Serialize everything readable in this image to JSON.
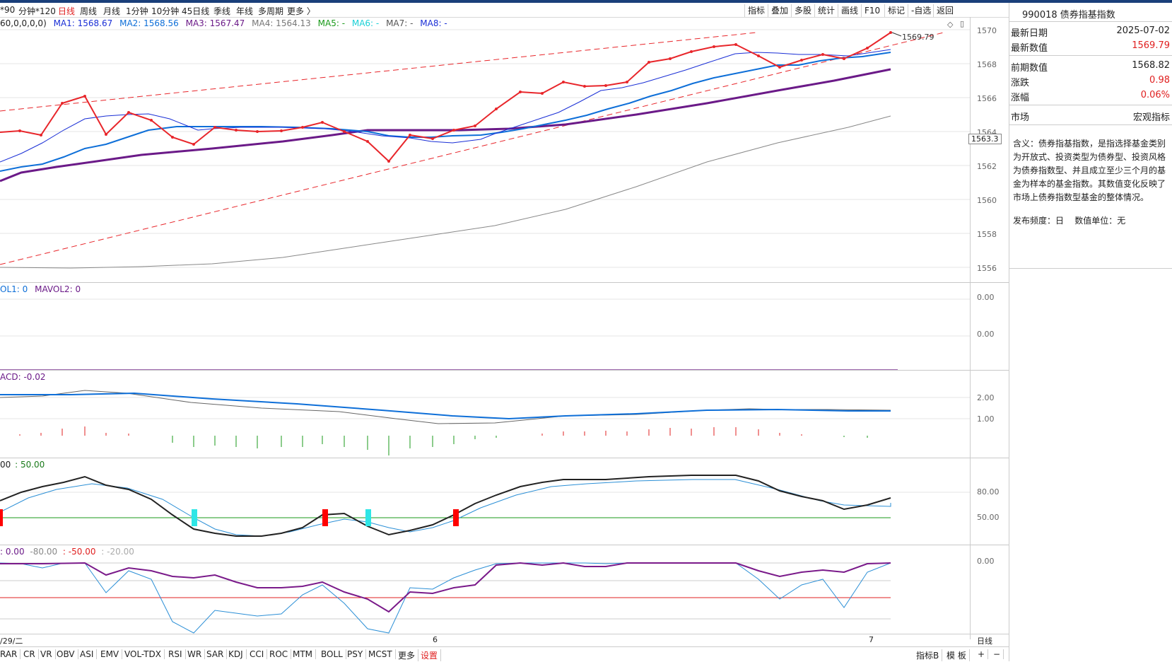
{
  "tabs": {
    "left_fragment": "*90",
    "items": [
      "分钟*120",
      "日线",
      "周线",
      "月线",
      "1分钟",
      "10分钟",
      "45日线",
      "季线",
      "年线",
      "多周期",
      "更多 〉"
    ],
    "active": "日线"
  },
  "toolbar": [
    "指标",
    "叠加",
    "多股",
    "统计",
    "画线",
    "F10",
    "标记",
    "-自选",
    "返回"
  ],
  "ma_legend": {
    "params": "60,0,0,0,0)",
    "ma1": "MA1: 1568.67",
    "ma2": "MA2: 1568.56",
    "ma3": "MA3: 1567.47",
    "ma4": "MA4: 1564.13",
    "ma5": "MA5: -",
    "ma6": "MA6: -",
    "ma7": "MA7: -",
    "ma8": "MA8: -"
  },
  "main_y_labels": [
    "1570",
    "1568",
    "1566",
    "1564",
    "1562",
    "1560",
    "1558",
    "1556"
  ],
  "current_price_tag": "1563.3",
  "high_annotation": "1569.79",
  "vol_legend": {
    "vol1": "OL1: 0",
    "mavol2": "MAVOL2: 0"
  },
  "vol_y_labels": [
    "0.00",
    "0.00"
  ],
  "macd_legend": "ACD: -0.02",
  "macd_y_labels": [
    "2.00",
    "1.00"
  ],
  "kdj_legend": {
    "a": "00",
    "b": ": 50.00"
  },
  "kdj_y_labels": [
    "80.00",
    "50.00"
  ],
  "wr_legend": {
    "a": ": 0.00",
    "b": "-80.00",
    "c": ": -50.00",
    "d": ": -20.00"
  },
  "wr_y_labels": [
    "0.00"
  ],
  "date_axis": {
    "left": "/29/二",
    "mid": "6",
    "right": "7",
    "period": "日线"
  },
  "bottom_tabs": [
    "RAR",
    "CR",
    "VR",
    "OBV",
    "ASI",
    "EMV",
    "VOL-TDX",
    "RSI",
    "WR",
    "SAR",
    "KDJ",
    "CCI",
    "ROC",
    "MTM",
    "BOLL",
    "PSY",
    "MCST",
    "更多",
    "设置"
  ],
  "bottom_right": [
    "指标B",
    "模 板",
    "+",
    "−"
  ],
  "info_panel": {
    "title": "990018 债券指基指数",
    "rows1": [
      {
        "k": "最新日期",
        "v": "2025-07-02",
        "color": "#222222"
      },
      {
        "k": "最新数值",
        "v": "1569.79",
        "color": "#e02020"
      }
    ],
    "rows2": [
      {
        "k": "前期数值",
        "v": "1568.82",
        "color": "#222222"
      },
      {
        "k": "涨跌",
        "v": "0.98",
        "color": "#e02020"
      },
      {
        "k": "涨幅",
        "v": "0.06%",
        "color": "#e02020"
      }
    ],
    "market_label": "市场",
    "market_value": "宏观指标",
    "description": "含义：债券指基指数，是指选择基金类别为开放式、投资类型为债券型、投资风格为债券指数型、并且成立至少三个月的基金为样本的基金指数。其数值变化反映了市场上债券指数型基金的整体情况。",
    "frequency": "发布频度：日",
    "unit": "数值单位：无"
  },
  "colors": {
    "price": "#e8262b",
    "ma1": "#1a2fd6",
    "ma2": "#0e6fd8",
    "ma3": "#6b1a88",
    "ma4": "#777777",
    "up": "#e02020",
    "kdj_k": "#222222",
    "kdj_d": "#2b8fd6",
    "wr1": "#7a1a8a",
    "wr2": "#2b8fd6"
  }
}
